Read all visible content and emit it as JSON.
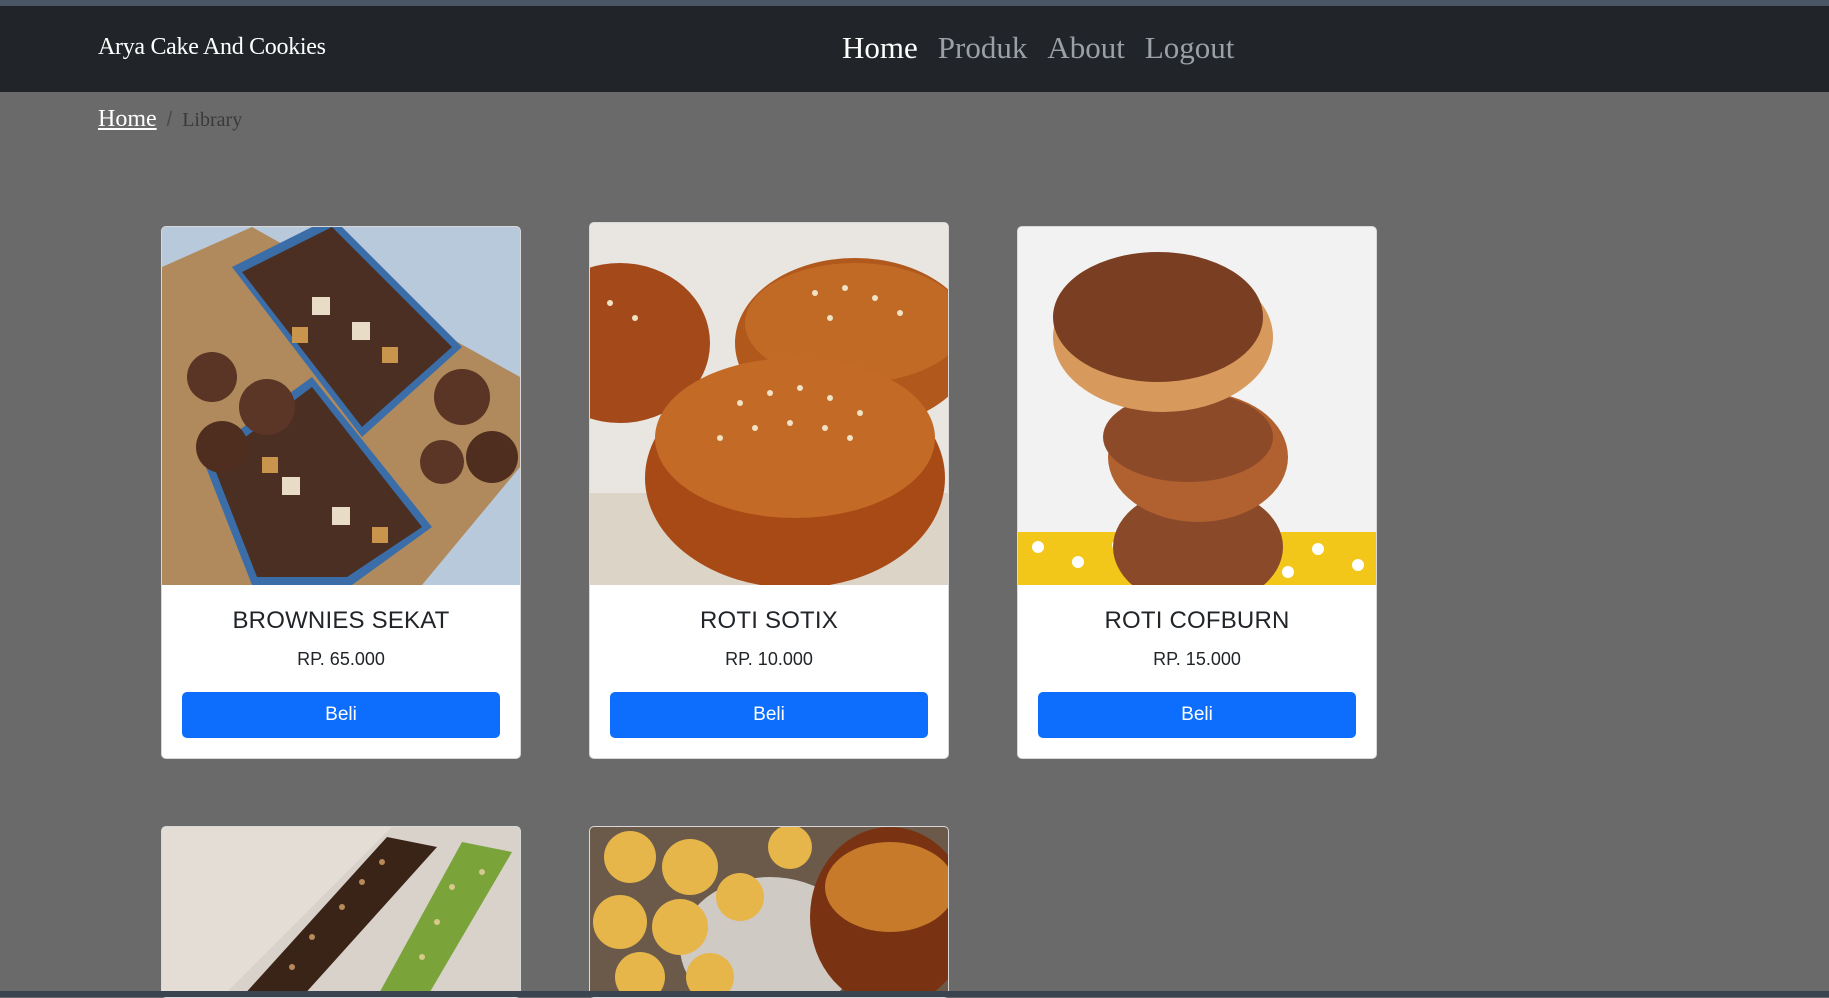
{
  "navbar": {
    "brand": "Arya Cake And Cookies",
    "links": [
      "Home",
      "Produk",
      "About",
      "Logout"
    ],
    "active": "Home"
  },
  "breadcrumb": {
    "home": "Home",
    "separator": "/",
    "current": "Library"
  },
  "products": [
    {
      "name": "BROWNIES SEKAT",
      "price": "RP. 65.000",
      "button": "Beli",
      "image": "brownies-box-photo"
    },
    {
      "name": "ROTI SOTIX",
      "price": "RP. 10.000",
      "button": "Beli",
      "image": "sesame-bun-photo"
    },
    {
      "name": "ROTI COFBURN",
      "price": "RP. 15.000",
      "button": "Beli",
      "image": "coffee-bun-stack-photo"
    },
    {
      "image": "chocolate-pandan-bars-photo"
    },
    {
      "image": "pineapple-tart-cookies-photo"
    }
  ],
  "colors": {
    "navbar": "#212529",
    "page_bg": "#6a6a6a",
    "button": "#0d6efd"
  }
}
